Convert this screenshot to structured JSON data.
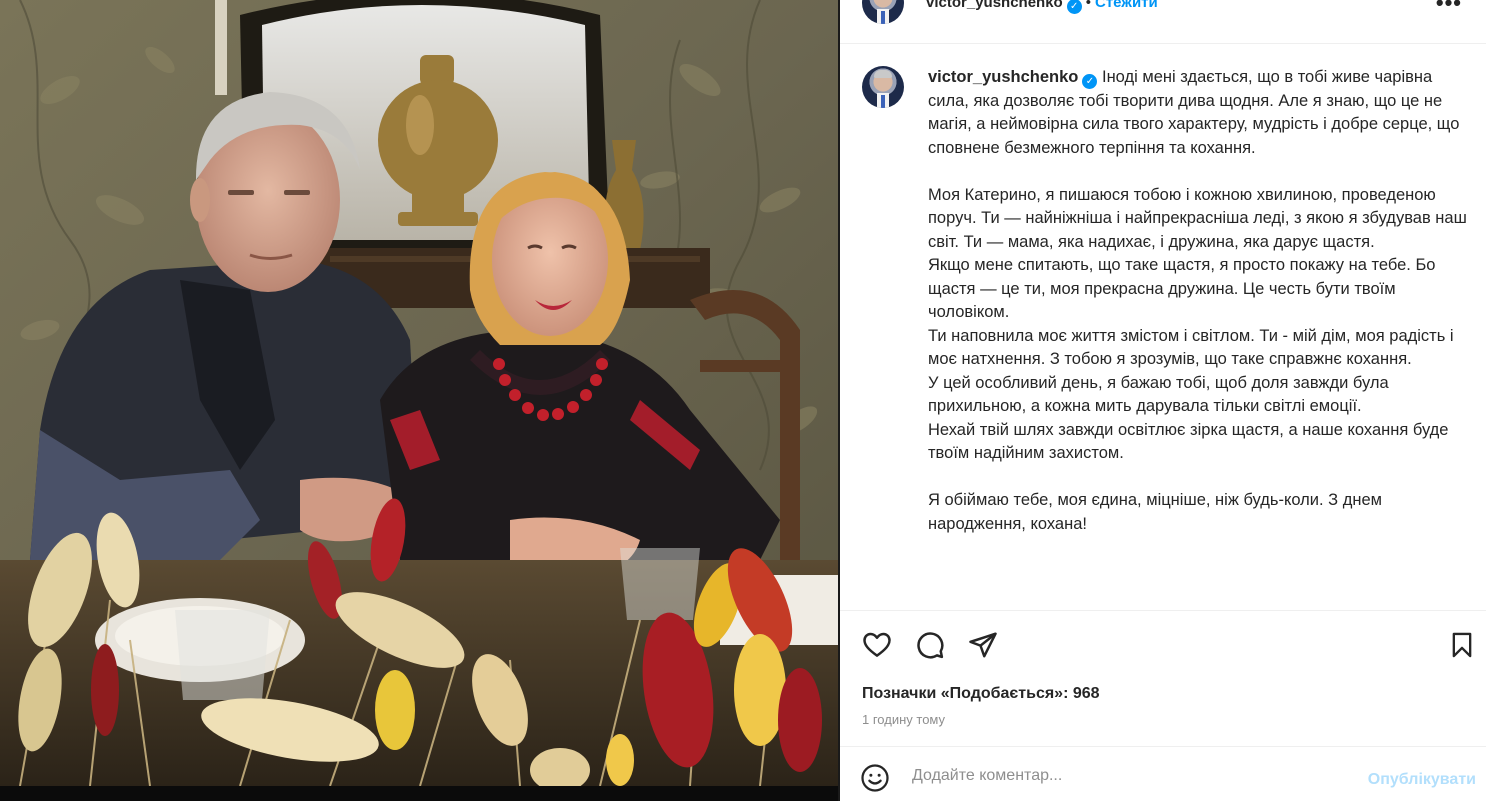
{
  "post": {
    "username": "victor_yushchenko",
    "verified": true,
    "follow_label": "Стежити",
    "more_label": "•••"
  },
  "caption": {
    "username": "victor_yushchenko",
    "paragraphs": [
      "Іноді мені здається, що в тобі живе чарівна сила, яка дозволяє тобі творити дива щодня. Але я знаю, що це не магія, а неймовірна сила твого характеру, мудрість і добре серце, що сповнене безмежного терпіння та кохання.",
      "",
      "Моя Катерино, я пишаюся тобою і кожною хвилиною, проведеною поруч. Ти — найніжніша і найпрекрасніша леді, з якою я збудував наш світ. Ти — мама, яка надихає, і дружина, яка дарує щастя.",
      "Якщо мене спитають, що таке щастя, я просто покажу на тебе. Бо щастя — це ти, моя прекрасна дружина. Це честь бути твоїм чоловіком.",
      "Ти наповнила моє життя змістом і світлом. Ти - мій дім, моя радість і моє натхнення. З тобою я зрозумів, що таке справжнє кохання.",
      "У цей особливий день, я бажаю тобі, щоб доля завжди була прихильною, а кожна мить дарувала тільки світлі емоції.",
      "Нехай твій шлях завжди освітлює зірка щастя, а наше кохання буде твоїм надійним захистом.",
      "",
      "Я обіймаю тебе, моя єдина, міцніше, ніж будь-коли. З днем народження, кохана!"
    ]
  },
  "actions": {
    "like_icon": "heart-icon",
    "comment_icon": "comment-icon",
    "share_icon": "send-icon",
    "save_icon": "bookmark-icon"
  },
  "likes": {
    "label": "Позначки «Подобається»:",
    "count": "968"
  },
  "time_ago": "1 годину тому",
  "comment": {
    "placeholder": "Додайте коментар...",
    "value": "",
    "publish_label": "Опублікувати"
  },
  "colors": {
    "accent": "#0095f6",
    "publish_disabled": "#b2dffc",
    "muted": "#8e8e8e"
  }
}
